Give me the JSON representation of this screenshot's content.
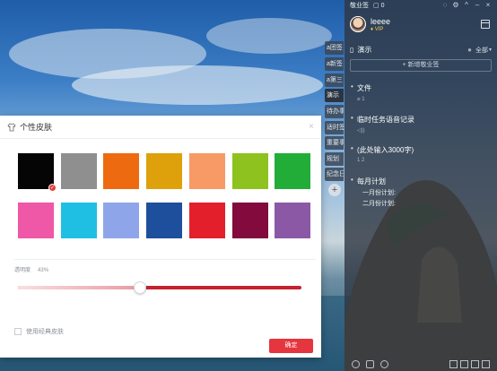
{
  "notes_app": {
    "app_name": "敬业签",
    "notification_count": "0",
    "user": {
      "name": "leeee",
      "badge": "VIP"
    },
    "category": {
      "name": "演示",
      "filter_label": "全部"
    },
    "new_note_label": "+ 新增敬业签",
    "notes": [
      {
        "title": "文件",
        "meta": "1"
      },
      {
        "title": "临时任务语音记录",
        "meta": ""
      },
      {
        "title": "(此处输入3000字)",
        "meta": "1   2"
      },
      {
        "title": "每月计划",
        "lines": [
          "一月份计划:",
          "二月份计划:"
        ]
      }
    ],
    "side_tabs": [
      "a团签",
      "a新签",
      "a第三",
      "演示",
      "待办事",
      "适时签",
      "重要事",
      "规划",
      "纪念日"
    ],
    "add_tab_label": "+"
  },
  "skin_dialog": {
    "title": "个性皮肤",
    "close_label": "×",
    "swatches_row1": [
      "#050505",
      "#8f8f8f",
      "#ee6a10",
      "#dea10c",
      "#f79a66",
      "#8dc21f",
      "#22ad38"
    ],
    "swatches_row2": [
      "#ef57a7",
      "#1fbfe4",
      "#8ea6e9",
      "#1e4f9d",
      "#e41f2c",
      "#820a3c",
      "#8b58a6"
    ],
    "selected_swatch_index": 0,
    "check_mark": "✓",
    "opacity_label": "透明度",
    "opacity_value": "43%",
    "opacity_fraction": 0.43,
    "classic_skin_label": "使用经典皮肤",
    "confirm_label": "确定"
  },
  "colors": {
    "accent": "#e5353f"
  }
}
